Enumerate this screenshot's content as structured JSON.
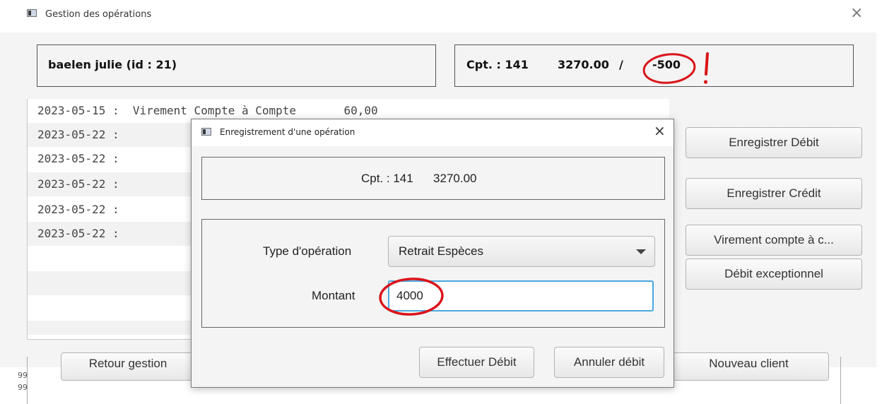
{
  "window": {
    "title": "Gestion des opérations",
    "close_glyph": "×"
  },
  "client": {
    "label": "baelen  julie  (id : 21)"
  },
  "account": {
    "number_label": "Cpt. : 141",
    "balance": "3270.00",
    "separator": "/",
    "overdraft": "-500",
    "exclamation": "!"
  },
  "operations": [
    "2023-05-15 :  Virement Compte à Compte       60,00",
    "2023-05-22 :",
    "2023-05-22 :",
    "2023-05-22 :",
    "2023-05-22 :",
    "2023-05-22 :"
  ],
  "side_buttons": {
    "debit": "Enregistrer Débit",
    "credit": "Enregistrer Crédit",
    "transfer": "Virement compte à c...",
    "exceptional": "Débit exceptionnel"
  },
  "bottom": {
    "back_button": "Retour gestion",
    "new_client_button": "Nouveau client",
    "tiny_a": "99",
    "tiny_b": "99"
  },
  "dialog": {
    "title": "Enregistrement d'une opération",
    "close_glyph": "×",
    "account_info": "Cpt. : 141      3270.00",
    "type_label": "Type d'opération",
    "type_value": "Retrait Espèces",
    "amount_label": "Montant",
    "amount_value": "4000",
    "submit_button": "Effectuer Débit",
    "cancel_button": "Annuler débit"
  },
  "colors": {
    "annotation_red": "#d9141a",
    "focus_blue": "#4aa8e0"
  }
}
